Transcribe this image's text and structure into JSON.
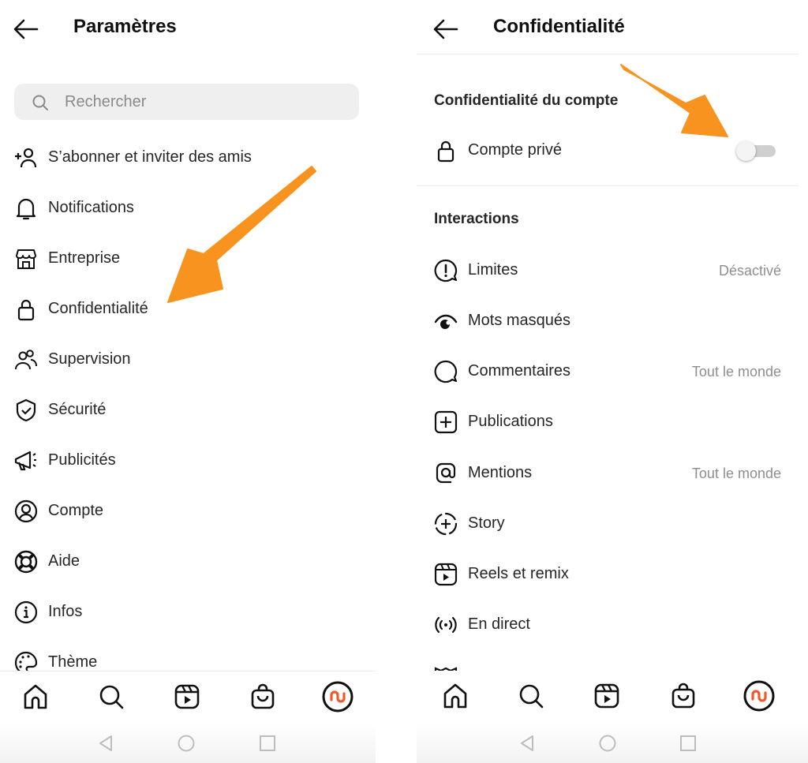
{
  "left": {
    "title": "Paramètres",
    "search_placeholder": "Rechercher",
    "items": [
      {
        "label": "S’abonner et inviter des amis",
        "icon": "add-person-icon"
      },
      {
        "label": "Notifications",
        "icon": "bell-icon"
      },
      {
        "label": "Entreprise",
        "icon": "shop-icon"
      },
      {
        "label": "Confidentialité",
        "icon": "lock-icon"
      },
      {
        "label": "Supervision",
        "icon": "people-icon"
      },
      {
        "label": "Sécurité",
        "icon": "shield-check-icon"
      },
      {
        "label": "Publicités",
        "icon": "megaphone-icon"
      },
      {
        "label": "Compte",
        "icon": "account-circle-icon"
      },
      {
        "label": "Aide",
        "icon": "lifebuoy-icon"
      },
      {
        "label": "Infos",
        "icon": "info-icon"
      },
      {
        "label": "Thème",
        "icon": "palette-icon"
      }
    ]
  },
  "right": {
    "title": "Confidentialité",
    "section_account": "Confidentialité du compte",
    "private_account": {
      "label": "Compte privé",
      "enabled": false
    },
    "section_interactions": "Interactions",
    "items": [
      {
        "label": "Limites",
        "value": "Désactivé",
        "icon": "alert-bubble-icon"
      },
      {
        "label": "Mots masqués",
        "value": "",
        "icon": "hidden-eye-icon"
      },
      {
        "label": "Commentaires",
        "value": "Tout le monde",
        "icon": "comment-icon"
      },
      {
        "label": "Publications",
        "value": "",
        "icon": "plus-square-icon"
      },
      {
        "label": "Mentions",
        "value": "Tout le monde",
        "icon": "at-icon"
      },
      {
        "label": "Story",
        "value": "",
        "icon": "story-add-icon"
      },
      {
        "label": "Reels et remix",
        "value": "",
        "icon": "reels-icon"
      },
      {
        "label": "En direct",
        "value": "",
        "icon": "live-icon"
      }
    ]
  },
  "tabbar": [
    "home-icon",
    "search-icon",
    "reels-icon",
    "shop-bag-icon",
    "profile-avatar"
  ],
  "navbar": [
    "back-triangle",
    "home-circle",
    "recents-square"
  ],
  "colors": {
    "annotation_arrow": "#f7931e",
    "avatar_accent": "#ef5a2a",
    "text": "#262626",
    "secondary": "#8e8e8e"
  }
}
